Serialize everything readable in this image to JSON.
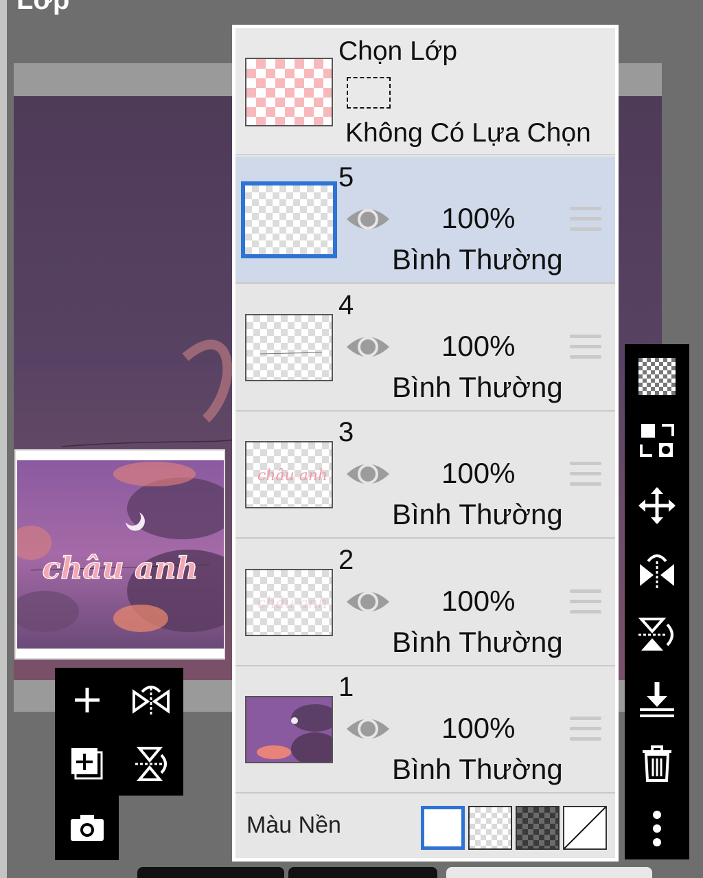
{
  "window": {
    "title": "Lớp"
  },
  "preview": {
    "caption": "châu anh"
  },
  "layer_panel": {
    "selection": {
      "title": "Chọn Lớp",
      "status": "Không Có Lựa Chọn"
    },
    "layers": [
      {
        "number": "5",
        "opacity": "100%",
        "blend": "Bình Thường",
        "active": true,
        "thumb": "empty"
      },
      {
        "number": "4",
        "opacity": "100%",
        "blend": "Bình Thường",
        "active": false,
        "thumb": "line"
      },
      {
        "number": "3",
        "opacity": "100%",
        "blend": "Bình Thường",
        "active": false,
        "thumb": "text"
      },
      {
        "number": "2",
        "opacity": "100%",
        "blend": "Bình Thường",
        "active": false,
        "thumb": "faint-text"
      },
      {
        "number": "1",
        "opacity": "100%",
        "blend": "Bình Thường",
        "active": false,
        "thumb": "sky-photo"
      }
    ],
    "background": {
      "label": "Màu Nền",
      "selected": "white",
      "options": [
        "white",
        "light-checker",
        "dark-checker",
        "transparent"
      ]
    }
  },
  "left_toolbar": {
    "buttons": [
      "add-layer-icon",
      "flip-horizontal-icon",
      "add-copy-layer-icon",
      "flip-vertical-icon",
      "camera-icon"
    ]
  },
  "right_toolbar": {
    "buttons": [
      "checker-icon",
      "swap-icon",
      "move-icon",
      "flip-horizontal-icon",
      "flip-vertical-icon",
      "merge-down-icon",
      "trash-icon",
      "more-icon"
    ]
  },
  "colors": {
    "active_layer_bg": "#cfd9e9",
    "accent_blue": "#2f73d4",
    "panel_bg": "#e6e6e6",
    "selection_checker": "#f7b9bc",
    "toolbar_bg": "#000000"
  }
}
